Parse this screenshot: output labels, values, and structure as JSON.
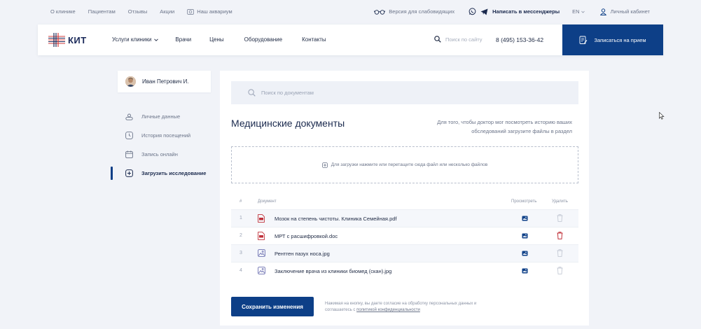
{
  "topbar": {
    "links": [
      "О клинике",
      "Пациентам",
      "Отзывы",
      "Акции"
    ],
    "aquarium": "Наш аквариум",
    "vision": "Версия для слабовидящих",
    "messenger": "Написать в мессенджеры",
    "lang": "EN",
    "cabinet": "Личный кабинет"
  },
  "header": {
    "logo": "КИТ",
    "services": "Услуги клиники",
    "nav": [
      "Врачи",
      "Цены",
      "Оборудование",
      "Контакты"
    ],
    "search_placeholder": "Поиск по сайту",
    "phone": "8 (495) 153-36-42",
    "book": "Записаться на прием"
  },
  "sidebar": {
    "user_name": "Иван Петрович И.",
    "items": [
      {
        "label": "Личные данные",
        "icon": "person-card-icon"
      },
      {
        "label": "История посещений",
        "icon": "clock-icon"
      },
      {
        "label": "Запись онлайн",
        "icon": "calendar-icon"
      },
      {
        "label": "Загрузить исследование",
        "icon": "plus-square-icon"
      }
    ],
    "active_index": 3
  },
  "main": {
    "search_placeholder": "Поиск по документам",
    "title": "Медицинские документы",
    "hint": "Для того, чтобы доктор мог посмотреть историю ваших обследований загрузите файлы в раздел",
    "dropzone": "Для загрузки нажмите или перетащите сюда файл или несколько файлов",
    "table": {
      "headers": {
        "num": "#",
        "doc": "Документ",
        "view": "Просмотреть",
        "del": "Удалить"
      },
      "rows": [
        {
          "num": "1",
          "name": "Мозок на степень чистоты. Клиника Семейная.pdf",
          "type": "pdf",
          "delete_active": false
        },
        {
          "num": "2",
          "name": "МРТ с расшифровкой.doc",
          "type": "pdf",
          "delete_active": true
        },
        {
          "num": "3",
          "name": "Рентген пазух носа.jpg",
          "type": "image",
          "delete_active": false
        },
        {
          "num": "4",
          "name": "Заключение врача из клиники биомед (скан).jpg",
          "type": "image",
          "delete_active": false
        }
      ]
    },
    "save": "Сохранить изменения",
    "consent_text": "Нажимая на кнопку, вы даете согласие на обработку персональных данных и соглашаетесь с",
    "consent_link": "политикой конфиденциальности"
  },
  "colors": {
    "accent": "#0d3f87",
    "danger": "#c0313a",
    "icon_muted": "#c5cad5",
    "logo_red": "#d23a3a"
  }
}
